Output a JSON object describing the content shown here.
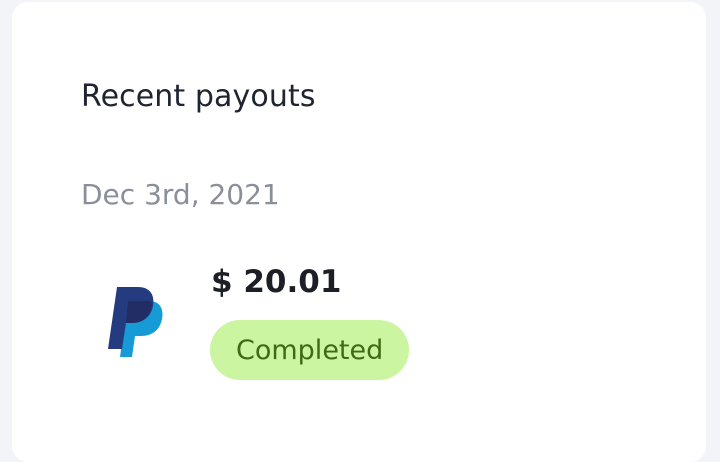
{
  "widget": {
    "title": "Recent payouts",
    "payouts": [
      {
        "date": "Dec 3rd, 2021",
        "provider_icon": "paypal-logo-icon",
        "amount": "$ 20.01",
        "status": "Completed",
        "status_color": "#cbf5a1"
      }
    ]
  },
  "colors": {
    "paypal_dark": "#253b80",
    "paypal_light": "#179bd7"
  }
}
